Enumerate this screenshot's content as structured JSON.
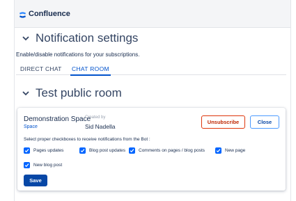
{
  "app": {
    "title": "Confluence",
    "icon": "confluence-logo-icon",
    "accent": "#0052cc"
  },
  "notification_settings": {
    "heading": "Notification settings",
    "description": "Enable/disable notifications for your subscriptions.",
    "tabs": [
      {
        "label": "DIRECT CHAT",
        "active": false
      },
      {
        "label": "CHAT ROOM",
        "active": true
      }
    ]
  },
  "room": {
    "heading": "Test public room",
    "space_name": "Demonstration Space",
    "space_link": "Space",
    "created_by_label": "Created by",
    "creator": "Sid Nadella",
    "unsubscribe_label": "Unsubscribe",
    "close_label": "Close",
    "prompt": "Select proper checkboxes to receive notifications from the Bot :",
    "options": [
      {
        "label": "Pages updates",
        "checked": true
      },
      {
        "label": "Blog post updates",
        "checked": true
      },
      {
        "label": "Comments on pages / blog posts",
        "checked": true
      },
      {
        "label": "New page",
        "checked": true
      },
      {
        "label": "New blog post",
        "checked": true
      }
    ],
    "save_label": "Save"
  }
}
